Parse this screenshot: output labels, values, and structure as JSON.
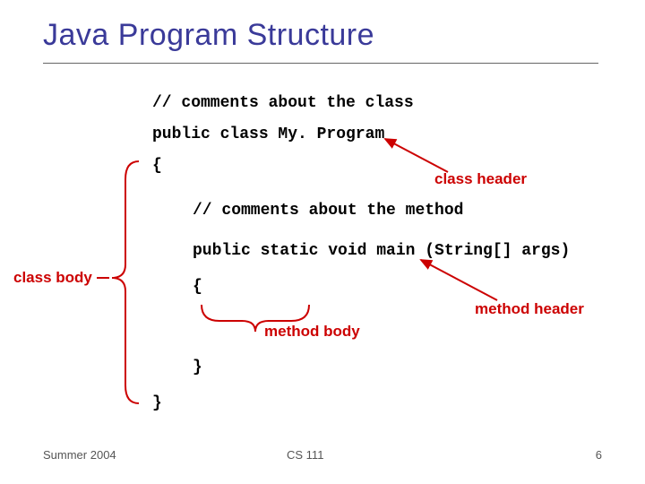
{
  "title": "Java Program Structure",
  "code": {
    "line1": "//  comments about the class",
    "line2": "public class My. Program",
    "line3": "{",
    "line4": "//  comments about the method",
    "line5": "public static void main (String[] args)",
    "line6": "{",
    "line7": "}",
    "line8": "}"
  },
  "annotations": {
    "class_header": "class header",
    "class_body": "class body",
    "method_header": "method header",
    "method_body": "method body"
  },
  "footer": {
    "left": "Summer 2004",
    "center": "CS 111",
    "right": "6"
  }
}
